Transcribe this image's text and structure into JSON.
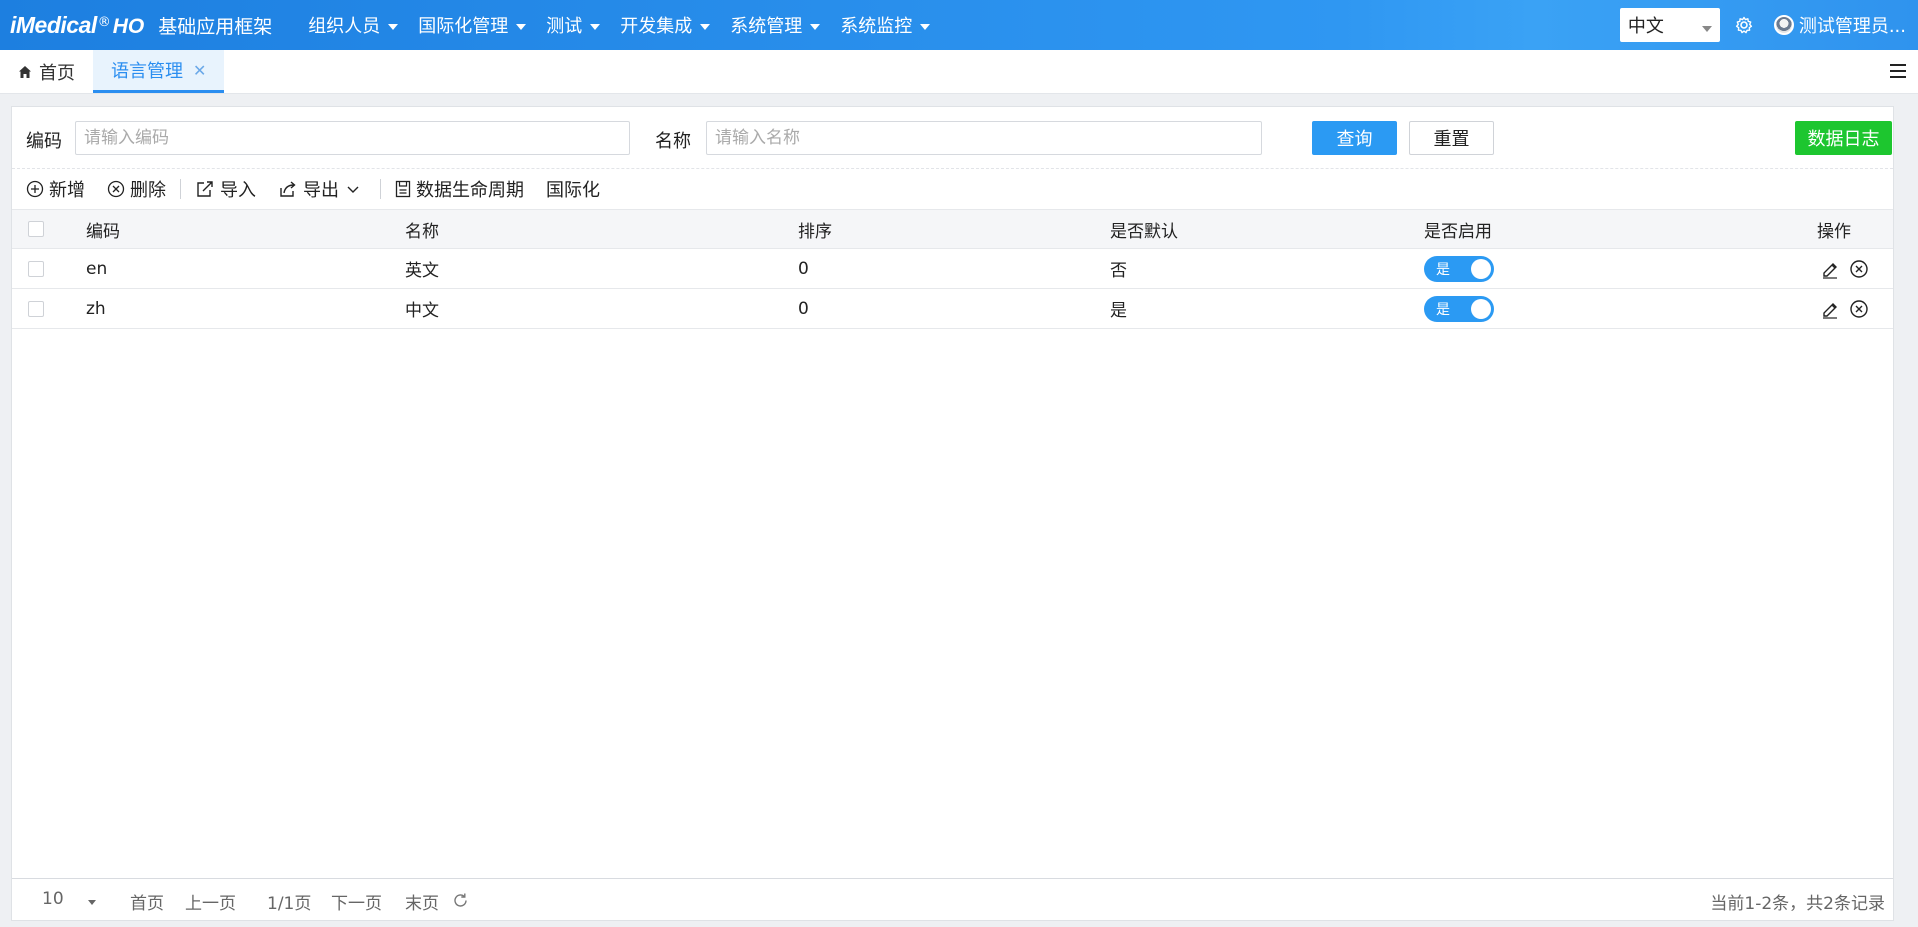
{
  "header": {
    "brand_logo": "iMedical",
    "brand_reg": "®",
    "brand_ho": "HO",
    "brand_title": "基础应用框架",
    "nav": [
      "组织人员",
      "国际化管理",
      "测试",
      "开发集成",
      "系统管理",
      "系统监控"
    ],
    "language": "中文",
    "user": "测试管理员..."
  },
  "tabs": [
    {
      "label": "首页",
      "active": false
    },
    {
      "label": "语言管理",
      "active": true
    }
  ],
  "search": {
    "code_label": "编码",
    "code_placeholder": "请输入编码",
    "name_label": "名称",
    "name_placeholder": "请输入名称",
    "query_button": "查询",
    "reset_button": "重置",
    "data_log_button": "数据日志"
  },
  "toolbar": {
    "add": "新增",
    "delete": "删除",
    "import": "导入",
    "export": "导出",
    "lifecycle": "数据生命周期",
    "i18n": "国际化"
  },
  "table": {
    "columns": [
      "编码",
      "名称",
      "排序",
      "是否默认",
      "是否启用",
      "操作"
    ],
    "rows": [
      {
        "code": "en",
        "name": "英文",
        "sort": "0",
        "is_default": "否",
        "enabled": "是"
      },
      {
        "code": "zh",
        "name": "中文",
        "sort": "0",
        "is_default": "是",
        "enabled": "是"
      }
    ]
  },
  "pager": {
    "page_size": "10",
    "first": "首页",
    "prev": "上一页",
    "current": "1/1页",
    "next": "下一页",
    "last": "末页",
    "info": "当前1-2条，共2条记录"
  },
  "colors": {
    "accent": "#2b9af3",
    "success": "#1dc62f",
    "header_start": "#1d7fe0"
  }
}
